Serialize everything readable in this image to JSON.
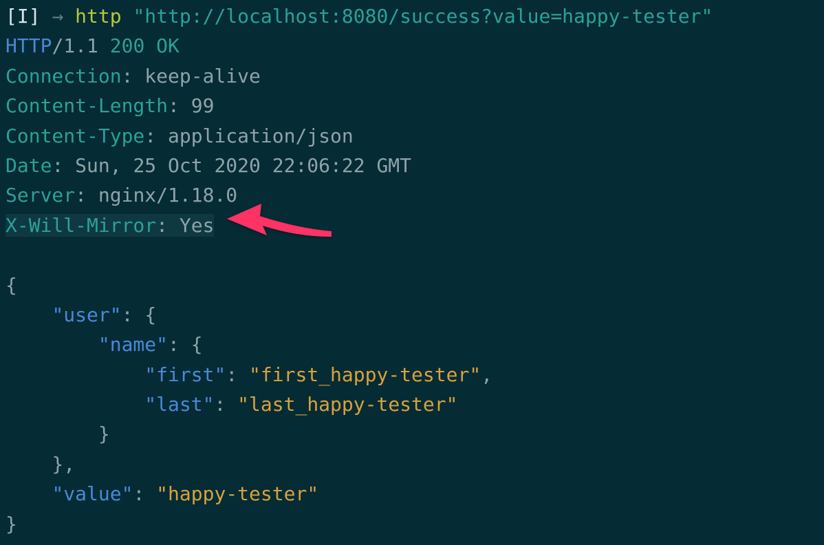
{
  "prompt": {
    "mode": "[I]",
    "arrow": "→",
    "command": "http",
    "arg": "\"http://localhost:8080/success?value=happy-tester\""
  },
  "status_line": {
    "protocol": "HTTP",
    "slash": "/",
    "version": "1.1",
    "code": "200",
    "reason": "OK"
  },
  "headers": [
    {
      "name": "Connection",
      "value": "keep-alive",
      "highlight": false
    },
    {
      "name": "Content-Length",
      "value": "99",
      "highlight": false
    },
    {
      "name": "Content-Type",
      "value": "application/json",
      "highlight": false
    },
    {
      "name": "Date",
      "value": "Sun, 25 Oct 2020 22:06:22 GMT",
      "highlight": false
    },
    {
      "name": "Server",
      "value": "nginx/1.18.0",
      "highlight": false
    },
    {
      "name": "X-Will-Mirror",
      "value": "Yes",
      "highlight": true
    }
  ],
  "json_body": {
    "keys": {
      "user": "\"user\"",
      "name": "\"name\"",
      "first": "\"first\"",
      "last": "\"last\"",
      "value": "\"value\""
    },
    "strings": {
      "first": "\"first_happy-tester\"",
      "last": "\"last_happy-tester\"",
      "value": "\"happy-tester\""
    }
  }
}
